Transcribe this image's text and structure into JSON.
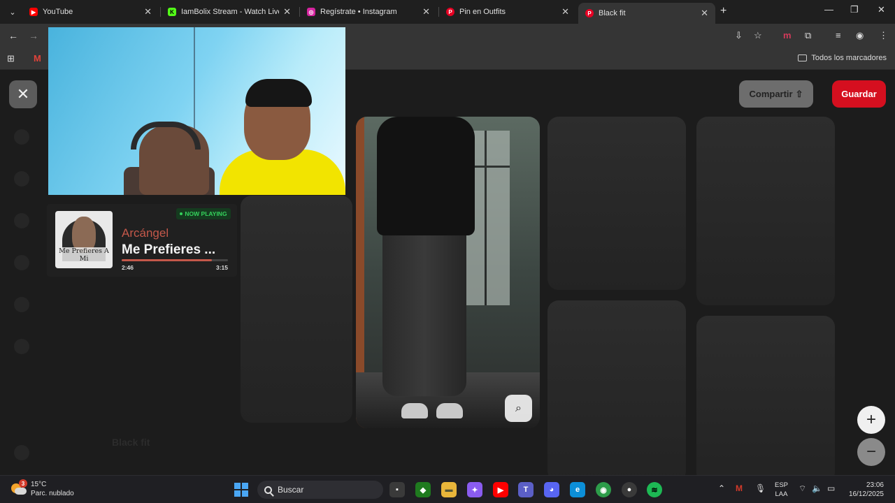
{
  "tabs": [
    {
      "title": "YouTube",
      "favicon": "youtube-icon",
      "color": "#ff0000"
    },
    {
      "title": "IamBolix Stream - Watch Live o",
      "favicon": "kick-icon",
      "color": "#53fc18"
    },
    {
      "title": "Regístrate • Instagram",
      "favicon": "instagram-icon",
      "color": "#d6249f"
    },
    {
      "title": "Pin en Outfits",
      "favicon": "pinterest-icon",
      "color": "#e60023"
    },
    {
      "title": "Black fit",
      "favicon": "pinterest-icon",
      "color": "#e60023",
      "active": true
    }
  ],
  "bookmarks": {
    "all_label": "Todos los marcadores"
  },
  "pinterest": {
    "share_label": "Compartir",
    "save_label": "Guardar",
    "pin_title": "Black fit",
    "accent": "#d50f1f"
  },
  "now_playing": {
    "badge": "NOW PLAYING",
    "artist": "Arcángel",
    "song": "Me Prefieres ...",
    "album_text": "Me Prefieres A Mi",
    "current_time": "2:46",
    "total_time": "3:15",
    "progress": 0.85,
    "accent": "#c4584a"
  },
  "taskbar": {
    "weather_temp": "15°C",
    "weather_desc": "Parc. nublado",
    "weather_badge": "3",
    "search_placeholder": "Buscar",
    "lang_line1": "ESP",
    "lang_line2": "LAA",
    "time": "23:06",
    "date": "16/12/2025"
  }
}
